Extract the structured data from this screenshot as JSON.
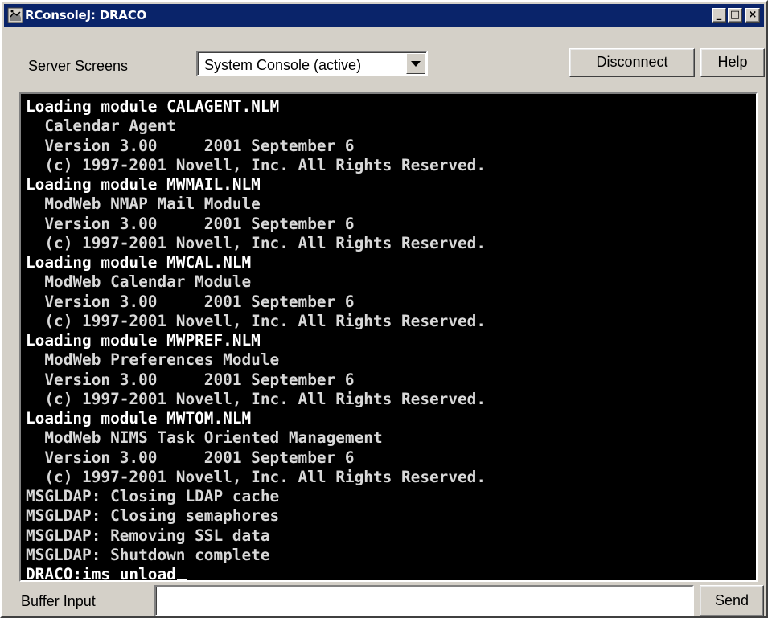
{
  "window": {
    "title": "RConsoleJ: DRACO",
    "minimize": "_",
    "maximize": "□",
    "close": "×"
  },
  "toolbar": {
    "server_screens_label": "Server Screens",
    "screen_select_value": "System Console (active)",
    "disconnect_label": "Disconnect",
    "help_label": "Help"
  },
  "console": {
    "lines": [
      {
        "text": "Loading module CALAGENT.NLM",
        "style": "hi"
      },
      {
        "text": "  Calendar Agent",
        "style": "normal"
      },
      {
        "text": "  Version 3.00     2001 September 6",
        "style": "normal"
      },
      {
        "text": "  (c) 1997-2001 Novell, Inc. All Rights Reserved.",
        "style": "normal"
      },
      {
        "text": "Loading module MWMAIL.NLM",
        "style": "hi"
      },
      {
        "text": "  ModWeb NMAP Mail Module",
        "style": "normal"
      },
      {
        "text": "  Version 3.00     2001 September 6",
        "style": "normal"
      },
      {
        "text": "  (c) 1997-2001 Novell, Inc. All Rights Reserved.",
        "style": "normal"
      },
      {
        "text": "Loading module MWCAL.NLM",
        "style": "hi"
      },
      {
        "text": "  ModWeb Calendar Module",
        "style": "normal"
      },
      {
        "text": "  Version 3.00     2001 September 6",
        "style": "normal"
      },
      {
        "text": "  (c) 1997-2001 Novell, Inc. All Rights Reserved.",
        "style": "normal"
      },
      {
        "text": "Loading module MWPREF.NLM",
        "style": "hi"
      },
      {
        "text": "  ModWeb Preferences Module",
        "style": "normal"
      },
      {
        "text": "  Version 3.00     2001 September 6",
        "style": "normal"
      },
      {
        "text": "  (c) 1997-2001 Novell, Inc. All Rights Reserved.",
        "style": "normal"
      },
      {
        "text": "Loading module MWTOM.NLM",
        "style": "hi"
      },
      {
        "text": "  ModWeb NIMS Task Oriented Management",
        "style": "normal"
      },
      {
        "text": "  Version 3.00     2001 September 6",
        "style": "normal"
      },
      {
        "text": "  (c) 1997-2001 Novell, Inc. All Rights Reserved.",
        "style": "normal"
      },
      {
        "text": "MSGLDAP: Closing LDAP cache",
        "style": "normal"
      },
      {
        "text": "MSGLDAP: Closing semaphores",
        "style": "normal"
      },
      {
        "text": "MSGLDAP: Removing SSL data",
        "style": "normal"
      },
      {
        "text": "MSGLDAP: Shutdown complete",
        "style": "normal"
      }
    ],
    "prompt": "DRACO:ims unload"
  },
  "buffer": {
    "label": "Buffer Input",
    "value": "",
    "send_label": "Send"
  },
  "colors": {
    "titlebar": "#0a246a",
    "console_bg": "#000000",
    "console_text": "#d8d8d8",
    "window_bg": "#d4d0c8"
  }
}
